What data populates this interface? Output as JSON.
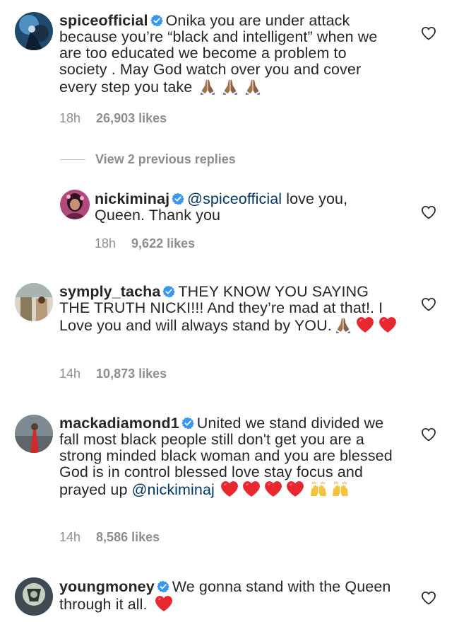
{
  "comments": [
    {
      "username": "spiceofficial",
      "text": "Onika you are under attack because you’re “black and intelligent” when we are too educated we become a problem to society . May God watch over you and cover every step you take",
      "emoji": "🙏🏾🙏🏾🙏🏾",
      "time": "18h",
      "likes": "26,903 likes"
    },
    {
      "username": "symply_tacha",
      "text": "THEY KNOW YOU SAYING THE TRUTH NICKI!!! And they’re mad at that!. I Love you and will always stand by YOU.",
      "emoji": "🙏🏾❤️❤️",
      "time": "14h",
      "likes": "10,873 likes"
    },
    {
      "username": "mackadiamond1",
      "text": "United we stand divided we fall most black people still don't get you are a strong minded black woman and you are blessed God is in control blessed love stay focus and prayed up",
      "mention": "@nickiminaj",
      "emoji": "❤️❤️❤️❤️🙌🙌",
      "time": "14h",
      "likes": "8,586 likes"
    },
    {
      "username": "youngmoney",
      "text": "We gonna stand with the Queen through it all.",
      "emoji": "❤️",
      "time": "",
      "likes": ""
    }
  ],
  "view_replies": "View 2 previous replies",
  "reply": {
    "username": "nickiminaj",
    "mention": "@spiceofficial",
    "text": "love you, Queen. Thank you",
    "time": "18h",
    "likes": "9,622 likes"
  },
  "colors": {
    "text": "#262626",
    "meta": "#8e8e8e",
    "mention": "#00376b",
    "verified": "#3897f0",
    "heart": "#e8272e"
  },
  "icons": {
    "verified": "verified-badge-icon",
    "like": "heart-outline-icon",
    "pray": "folded-hands-emoji",
    "heart": "red-heart-emoji",
    "raise": "raising-hands-emoji"
  }
}
